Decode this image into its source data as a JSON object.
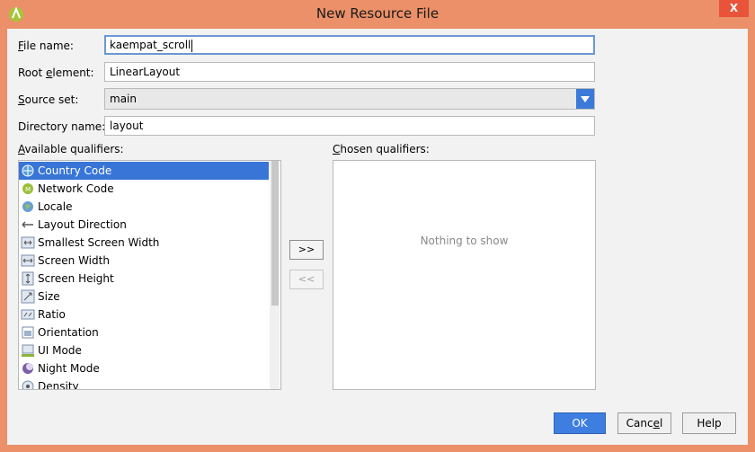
{
  "window": {
    "title": "New Resource File",
    "close_glyph": "X"
  },
  "form": {
    "file_name": {
      "label_u": "F",
      "label_rest": "ile name:",
      "value": "kaempat_scroll"
    },
    "root_element": {
      "label_pre": "Root ",
      "label_u": "e",
      "label_rest": "lement:",
      "value": "LinearLayout"
    },
    "source_set": {
      "label_u": "S",
      "label_rest": "ource set:",
      "value": "main"
    },
    "directory_name": {
      "label": "Directory name:",
      "value": "layout"
    }
  },
  "qualifiers": {
    "available_label_u": "A",
    "available_label_rest": "vailable qualifiers:",
    "chosen_label_u": "C",
    "chosen_label_rest": "hosen qualifiers:",
    "available": [
      {
        "label": "Country Code",
        "icon": "globe-icon"
      },
      {
        "label": "Network Code",
        "icon": "network-icon"
      },
      {
        "label": "Locale",
        "icon": "globe-icon"
      },
      {
        "label": "Layout Direction",
        "icon": "layout-direction-icon"
      },
      {
        "label": "Smallest Screen Width",
        "icon": "screen-width-icon"
      },
      {
        "label": "Screen Width",
        "icon": "screen-width-icon"
      },
      {
        "label": "Screen Height",
        "icon": "screen-height-icon"
      },
      {
        "label": "Size",
        "icon": "size-icon"
      },
      {
        "label": "Ratio",
        "icon": "ratio-icon"
      },
      {
        "label": "Orientation",
        "icon": "orientation-icon"
      },
      {
        "label": "UI Mode",
        "icon": "ui-mode-icon"
      },
      {
        "label": "Night Mode",
        "icon": "night-mode-icon"
      },
      {
        "label": "Density",
        "icon": "density-icon"
      }
    ],
    "chosen_empty_text": "Nothing to show",
    "add_button": ">>",
    "remove_button": "<<"
  },
  "buttons": {
    "ok": "OK",
    "cancel_pre": "Canc",
    "cancel_u": "e",
    "cancel_rest": "l",
    "help": "Help"
  },
  "colors": {
    "accent": "#3875d7",
    "titlebar": "#eb9068",
    "close": "#e8533a"
  }
}
